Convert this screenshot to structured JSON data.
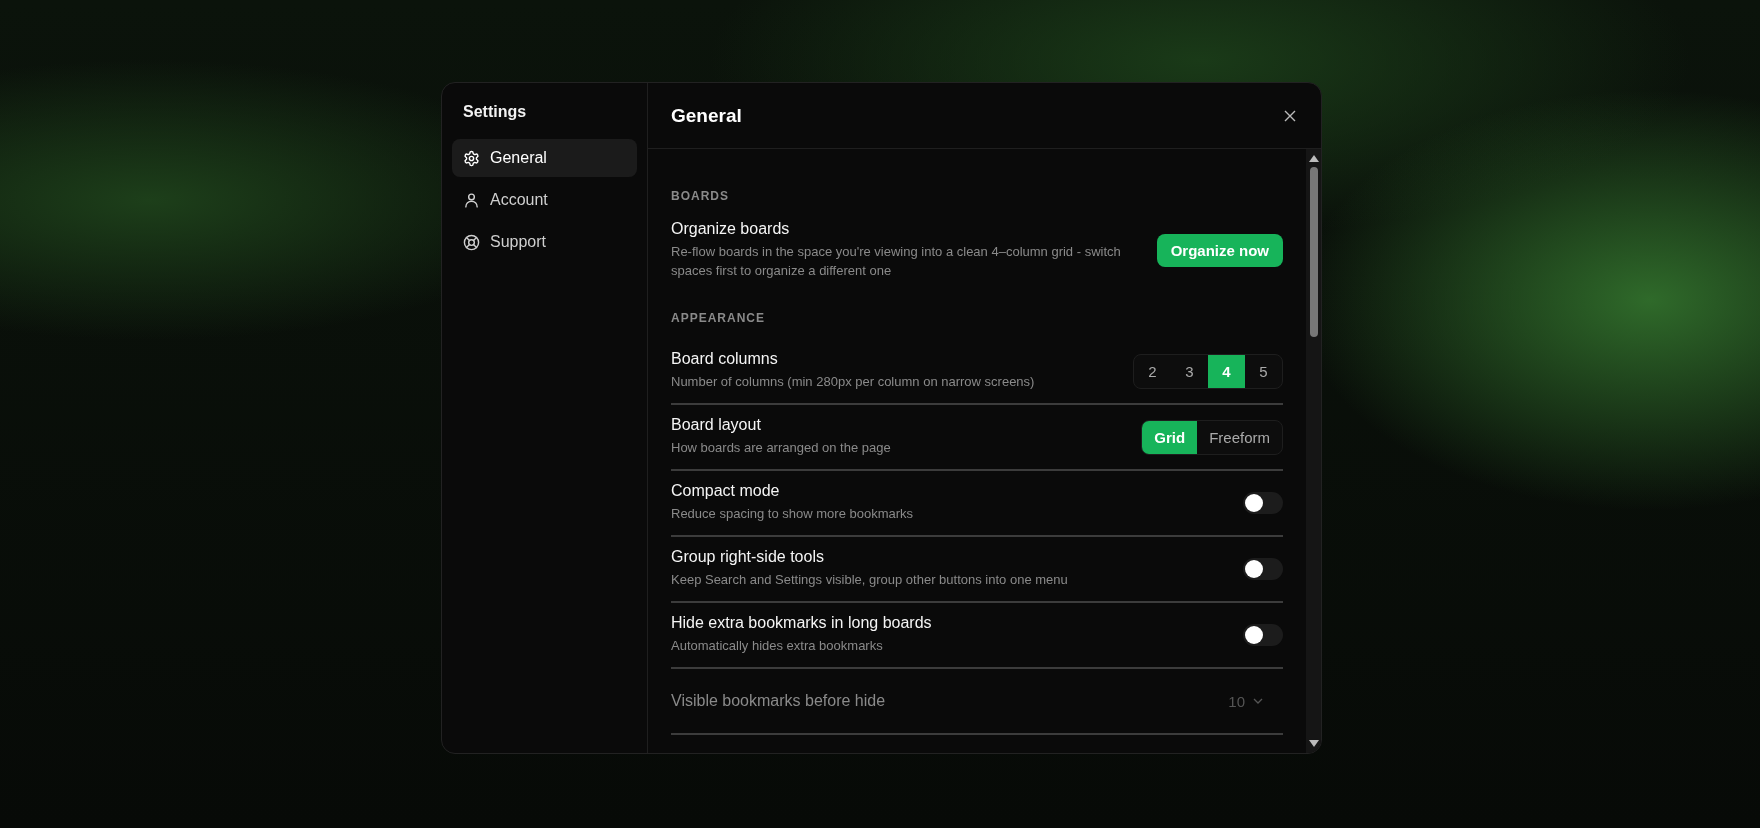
{
  "dialog": {
    "title": "Settings",
    "heading": "General"
  },
  "nav": [
    {
      "label": "General",
      "selected": true
    },
    {
      "label": "Account",
      "selected": false
    },
    {
      "label": "Support",
      "selected": false
    }
  ],
  "sections": [
    {
      "title": "BOARDS",
      "rows": [
        {
          "kind": "action",
          "title": "Organize boards",
          "description": "Re-flow boards in the space you're viewing into a clean 4–column grid - switch spaces first to organize a different one",
          "button": "Organize now"
        }
      ]
    },
    {
      "title": "APPEARANCE",
      "rows": [
        {
          "kind": "segmented",
          "title": "Board columns",
          "description": "Number of columns (min 280px per column on narrow screens)",
          "options": [
            {
              "label": "2",
              "selected": false
            },
            {
              "label": "3",
              "selected": false
            },
            {
              "label": "4",
              "selected": true
            },
            {
              "label": "5",
              "selected": false
            }
          ]
        },
        {
          "kind": "segmented",
          "title": "Board layout",
          "description": "How boards are arranged on the page",
          "options": [
            {
              "label": "Grid",
              "selected": true
            },
            {
              "label": "Freeform",
              "selected": false
            }
          ]
        },
        {
          "kind": "toggle",
          "title": "Compact mode",
          "description": "Reduce spacing to show more bookmarks",
          "on": false
        },
        {
          "kind": "toggle",
          "title": "Group right-side tools",
          "description": "Keep Search and Settings visible, group other buttons into one menu",
          "on": false
        },
        {
          "kind": "toggle",
          "title": "Hide extra bookmarks in long boards",
          "description": "Automatically hides extra bookmarks",
          "on": false
        },
        {
          "kind": "select",
          "title": "Visible bookmarks before hide",
          "value": "10",
          "disabled": true
        }
      ]
    }
  ]
}
